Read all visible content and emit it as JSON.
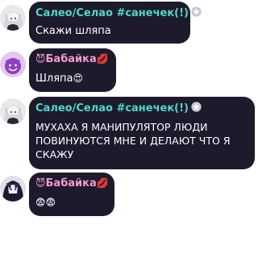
{
  "messages": [
    {
      "author": "Салео/Селао #санечек(!)",
      "author_color": "#4fd8c8",
      "author_badge_icon": "star-icon",
      "text": "Скажи шляпа",
      "avatar_icon": "anime-avatar-icon"
    },
    {
      "author_prefix_emoji": "😈",
      "author": "Бабайка",
      "author_suffix_emoji": "💋",
      "author_color": "#f09ad0",
      "text": "Шляпа",
      "text_emoji": "😍",
      "avatar_icon": "devil-avatar-icon"
    },
    {
      "author": "Салео/Селао #санечек(!)",
      "author_color": "#4fd8c8",
      "author_badge_icon": "star-icon",
      "text_line1": "МУХАХА Я МАНИПУЛЯТОР ЛЮДИ",
      "text_line2": "ПОВИНУЮТСЯ МНЕ И ДЕЛАЮТ ЧТО Я",
      "text_line3": "СКАЖУ",
      "avatar_icon": "anime-avatar-icon"
    },
    {
      "author_prefix_emoji": "😈",
      "author": "Бабайка",
      "author_suffix_emoji": "💋",
      "author_color": "#f09ad0",
      "text_emoji": "😨😨",
      "avatar_icon": "anime-avatar-dark-icon"
    }
  ]
}
